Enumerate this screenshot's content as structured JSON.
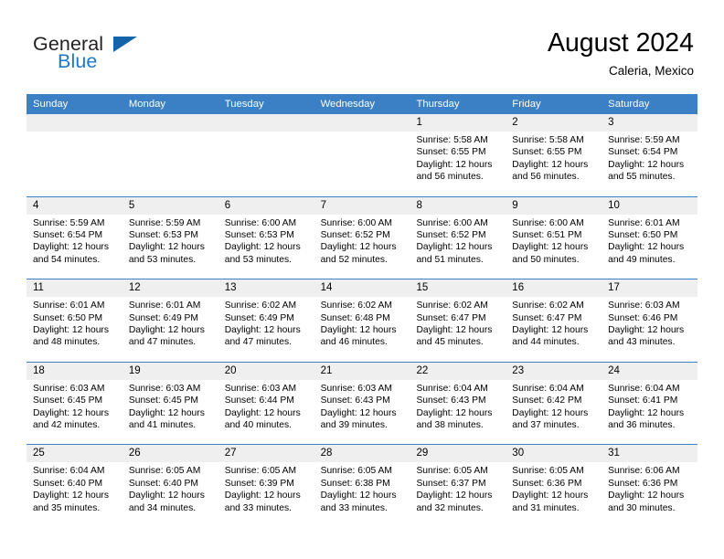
{
  "brand": {
    "name_top": "General",
    "name_bottom": "Blue",
    "flag_icon": "blue-flag-icon",
    "accent_color": "#1e78c8"
  },
  "header": {
    "title": "August 2024",
    "subtitle": "Caleria, Mexico"
  },
  "calendar": {
    "header_bg": "#3b7fc4",
    "daynum_bg": "#efefef",
    "weekdays": [
      "Sunday",
      "Monday",
      "Tuesday",
      "Wednesday",
      "Thursday",
      "Friday",
      "Saturday"
    ],
    "weeks": [
      [
        {
          "day": "",
          "empty": true,
          "sunrise": "",
          "sunset": "",
          "daylight_1": "",
          "daylight_2": ""
        },
        {
          "day": "",
          "empty": true,
          "sunrise": "",
          "sunset": "",
          "daylight_1": "",
          "daylight_2": ""
        },
        {
          "day": "",
          "empty": true,
          "sunrise": "",
          "sunset": "",
          "daylight_1": "",
          "daylight_2": ""
        },
        {
          "day": "",
          "empty": true,
          "sunrise": "",
          "sunset": "",
          "daylight_1": "",
          "daylight_2": ""
        },
        {
          "day": "1",
          "empty": false,
          "sunrise": "Sunrise: 5:58 AM",
          "sunset": "Sunset: 6:55 PM",
          "daylight_1": "Daylight: 12 hours",
          "daylight_2": "and 56 minutes."
        },
        {
          "day": "2",
          "empty": false,
          "sunrise": "Sunrise: 5:58 AM",
          "sunset": "Sunset: 6:55 PM",
          "daylight_1": "Daylight: 12 hours",
          "daylight_2": "and 56 minutes."
        },
        {
          "day": "3",
          "empty": false,
          "sunrise": "Sunrise: 5:59 AM",
          "sunset": "Sunset: 6:54 PM",
          "daylight_1": "Daylight: 12 hours",
          "daylight_2": "and 55 minutes."
        }
      ],
      [
        {
          "day": "4",
          "empty": false,
          "sunrise": "Sunrise: 5:59 AM",
          "sunset": "Sunset: 6:54 PM",
          "daylight_1": "Daylight: 12 hours",
          "daylight_2": "and 54 minutes."
        },
        {
          "day": "5",
          "empty": false,
          "sunrise": "Sunrise: 5:59 AM",
          "sunset": "Sunset: 6:53 PM",
          "daylight_1": "Daylight: 12 hours",
          "daylight_2": "and 53 minutes."
        },
        {
          "day": "6",
          "empty": false,
          "sunrise": "Sunrise: 6:00 AM",
          "sunset": "Sunset: 6:53 PM",
          "daylight_1": "Daylight: 12 hours",
          "daylight_2": "and 53 minutes."
        },
        {
          "day": "7",
          "empty": false,
          "sunrise": "Sunrise: 6:00 AM",
          "sunset": "Sunset: 6:52 PM",
          "daylight_1": "Daylight: 12 hours",
          "daylight_2": "and 52 minutes."
        },
        {
          "day": "8",
          "empty": false,
          "sunrise": "Sunrise: 6:00 AM",
          "sunset": "Sunset: 6:52 PM",
          "daylight_1": "Daylight: 12 hours",
          "daylight_2": "and 51 minutes."
        },
        {
          "day": "9",
          "empty": false,
          "sunrise": "Sunrise: 6:00 AM",
          "sunset": "Sunset: 6:51 PM",
          "daylight_1": "Daylight: 12 hours",
          "daylight_2": "and 50 minutes."
        },
        {
          "day": "10",
          "empty": false,
          "sunrise": "Sunrise: 6:01 AM",
          "sunset": "Sunset: 6:50 PM",
          "daylight_1": "Daylight: 12 hours",
          "daylight_2": "and 49 minutes."
        }
      ],
      [
        {
          "day": "11",
          "empty": false,
          "sunrise": "Sunrise: 6:01 AM",
          "sunset": "Sunset: 6:50 PM",
          "daylight_1": "Daylight: 12 hours",
          "daylight_2": "and 48 minutes."
        },
        {
          "day": "12",
          "empty": false,
          "sunrise": "Sunrise: 6:01 AM",
          "sunset": "Sunset: 6:49 PM",
          "daylight_1": "Daylight: 12 hours",
          "daylight_2": "and 47 minutes."
        },
        {
          "day": "13",
          "empty": false,
          "sunrise": "Sunrise: 6:02 AM",
          "sunset": "Sunset: 6:49 PM",
          "daylight_1": "Daylight: 12 hours",
          "daylight_2": "and 47 minutes."
        },
        {
          "day": "14",
          "empty": false,
          "sunrise": "Sunrise: 6:02 AM",
          "sunset": "Sunset: 6:48 PM",
          "daylight_1": "Daylight: 12 hours",
          "daylight_2": "and 46 minutes."
        },
        {
          "day": "15",
          "empty": false,
          "sunrise": "Sunrise: 6:02 AM",
          "sunset": "Sunset: 6:47 PM",
          "daylight_1": "Daylight: 12 hours",
          "daylight_2": "and 45 minutes."
        },
        {
          "day": "16",
          "empty": false,
          "sunrise": "Sunrise: 6:02 AM",
          "sunset": "Sunset: 6:47 PM",
          "daylight_1": "Daylight: 12 hours",
          "daylight_2": "and 44 minutes."
        },
        {
          "day": "17",
          "empty": false,
          "sunrise": "Sunrise: 6:03 AM",
          "sunset": "Sunset: 6:46 PM",
          "daylight_1": "Daylight: 12 hours",
          "daylight_2": "and 43 minutes."
        }
      ],
      [
        {
          "day": "18",
          "empty": false,
          "sunrise": "Sunrise: 6:03 AM",
          "sunset": "Sunset: 6:45 PM",
          "daylight_1": "Daylight: 12 hours",
          "daylight_2": "and 42 minutes."
        },
        {
          "day": "19",
          "empty": false,
          "sunrise": "Sunrise: 6:03 AM",
          "sunset": "Sunset: 6:45 PM",
          "daylight_1": "Daylight: 12 hours",
          "daylight_2": "and 41 minutes."
        },
        {
          "day": "20",
          "empty": false,
          "sunrise": "Sunrise: 6:03 AM",
          "sunset": "Sunset: 6:44 PM",
          "daylight_1": "Daylight: 12 hours",
          "daylight_2": "and 40 minutes."
        },
        {
          "day": "21",
          "empty": false,
          "sunrise": "Sunrise: 6:03 AM",
          "sunset": "Sunset: 6:43 PM",
          "daylight_1": "Daylight: 12 hours",
          "daylight_2": "and 39 minutes."
        },
        {
          "day": "22",
          "empty": false,
          "sunrise": "Sunrise: 6:04 AM",
          "sunset": "Sunset: 6:43 PM",
          "daylight_1": "Daylight: 12 hours",
          "daylight_2": "and 38 minutes."
        },
        {
          "day": "23",
          "empty": false,
          "sunrise": "Sunrise: 6:04 AM",
          "sunset": "Sunset: 6:42 PM",
          "daylight_1": "Daylight: 12 hours",
          "daylight_2": "and 37 minutes."
        },
        {
          "day": "24",
          "empty": false,
          "sunrise": "Sunrise: 6:04 AM",
          "sunset": "Sunset: 6:41 PM",
          "daylight_1": "Daylight: 12 hours",
          "daylight_2": "and 36 minutes."
        }
      ],
      [
        {
          "day": "25",
          "empty": false,
          "sunrise": "Sunrise: 6:04 AM",
          "sunset": "Sunset: 6:40 PM",
          "daylight_1": "Daylight: 12 hours",
          "daylight_2": "and 35 minutes."
        },
        {
          "day": "26",
          "empty": false,
          "sunrise": "Sunrise: 6:05 AM",
          "sunset": "Sunset: 6:40 PM",
          "daylight_1": "Daylight: 12 hours",
          "daylight_2": "and 34 minutes."
        },
        {
          "day": "27",
          "empty": false,
          "sunrise": "Sunrise: 6:05 AM",
          "sunset": "Sunset: 6:39 PM",
          "daylight_1": "Daylight: 12 hours",
          "daylight_2": "and 33 minutes."
        },
        {
          "day": "28",
          "empty": false,
          "sunrise": "Sunrise: 6:05 AM",
          "sunset": "Sunset: 6:38 PM",
          "daylight_1": "Daylight: 12 hours",
          "daylight_2": "and 33 minutes."
        },
        {
          "day": "29",
          "empty": false,
          "sunrise": "Sunrise: 6:05 AM",
          "sunset": "Sunset: 6:37 PM",
          "daylight_1": "Daylight: 12 hours",
          "daylight_2": "and 32 minutes."
        },
        {
          "day": "30",
          "empty": false,
          "sunrise": "Sunrise: 6:05 AM",
          "sunset": "Sunset: 6:36 PM",
          "daylight_1": "Daylight: 12 hours",
          "daylight_2": "and 31 minutes."
        },
        {
          "day": "31",
          "empty": false,
          "sunrise": "Sunrise: 6:06 AM",
          "sunset": "Sunset: 6:36 PM",
          "daylight_1": "Daylight: 12 hours",
          "daylight_2": "and 30 minutes."
        }
      ]
    ]
  }
}
